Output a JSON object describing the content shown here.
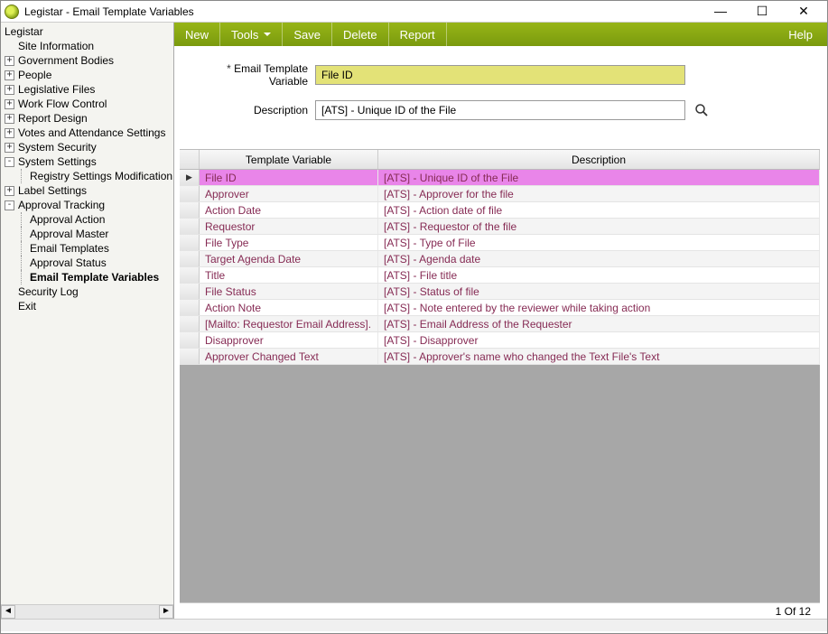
{
  "window": {
    "title": "Legistar - Email Template Variables"
  },
  "toolbar": {
    "new": "New",
    "tools": "Tools",
    "save": "Save",
    "delete": "Delete",
    "report": "Report",
    "help": "Help"
  },
  "sidebar": {
    "root": "Legistar",
    "items": [
      {
        "label": "Site Information",
        "expander": "",
        "noexp": true
      },
      {
        "label": "Government Bodies",
        "expander": "+"
      },
      {
        "label": "People",
        "expander": "+"
      },
      {
        "label": "Legislative Files",
        "expander": "+"
      },
      {
        "label": "Work Flow Control",
        "expander": "+"
      },
      {
        "label": "Report Design",
        "expander": "+"
      },
      {
        "label": "Votes and Attendance Settings",
        "expander": "+"
      },
      {
        "label": "System Security",
        "expander": "+"
      },
      {
        "label": "System Settings",
        "expander": "-",
        "children": [
          {
            "label": "Registry Settings Modification"
          }
        ]
      },
      {
        "label": "Label Settings",
        "expander": "+"
      },
      {
        "label": "Approval Tracking",
        "expander": "-",
        "children": [
          {
            "label": "Approval Action"
          },
          {
            "label": "Approval Master"
          },
          {
            "label": "Email Templates"
          },
          {
            "label": "Approval Status"
          },
          {
            "label": "Email Template Variables",
            "active": true
          }
        ]
      },
      {
        "label": "Security Log",
        "expander": "",
        "noexp": true
      },
      {
        "label": "Exit",
        "expander": "",
        "noexp": true
      }
    ]
  },
  "form": {
    "var_label": "Email Template Variable",
    "var_value": "File ID",
    "desc_label": "Description",
    "desc_value": "[ATS] - Unique ID of the File"
  },
  "grid": {
    "headers": {
      "var": "Template Variable",
      "desc": "Description"
    },
    "rows": [
      {
        "var": "File ID",
        "desc": "[ATS] - Unique ID of the File",
        "selected": true
      },
      {
        "var": "Approver",
        "desc": "[ATS] - Approver for the file"
      },
      {
        "var": "Action Date",
        "desc": "[ATS] - Action date of file"
      },
      {
        "var": "Requestor",
        "desc": "[ATS] - Requestor of the file"
      },
      {
        "var": "File Type",
        "desc": "[ATS] - Type of File"
      },
      {
        "var": "Target Agenda Date",
        "desc": "[ATS] - Agenda date"
      },
      {
        "var": "Title",
        "desc": "[ATS] - File title"
      },
      {
        "var": "File Status",
        "desc": "[ATS] - Status of file"
      },
      {
        "var": "Action Note",
        "desc": "[ATS] - Note entered by the reviewer while taking action"
      },
      {
        "var": "[Mailto: Requestor Email Address].",
        "desc": "[ATS] - Email Address of the Requester"
      },
      {
        "var": "Disapprover",
        "desc": "[ATS] - Disapprover"
      },
      {
        "var": "Approver Changed Text",
        "desc": "[ATS] - Approver's name who changed the Text File's Text"
      }
    ]
  },
  "status": {
    "text": "1 Of 12"
  }
}
